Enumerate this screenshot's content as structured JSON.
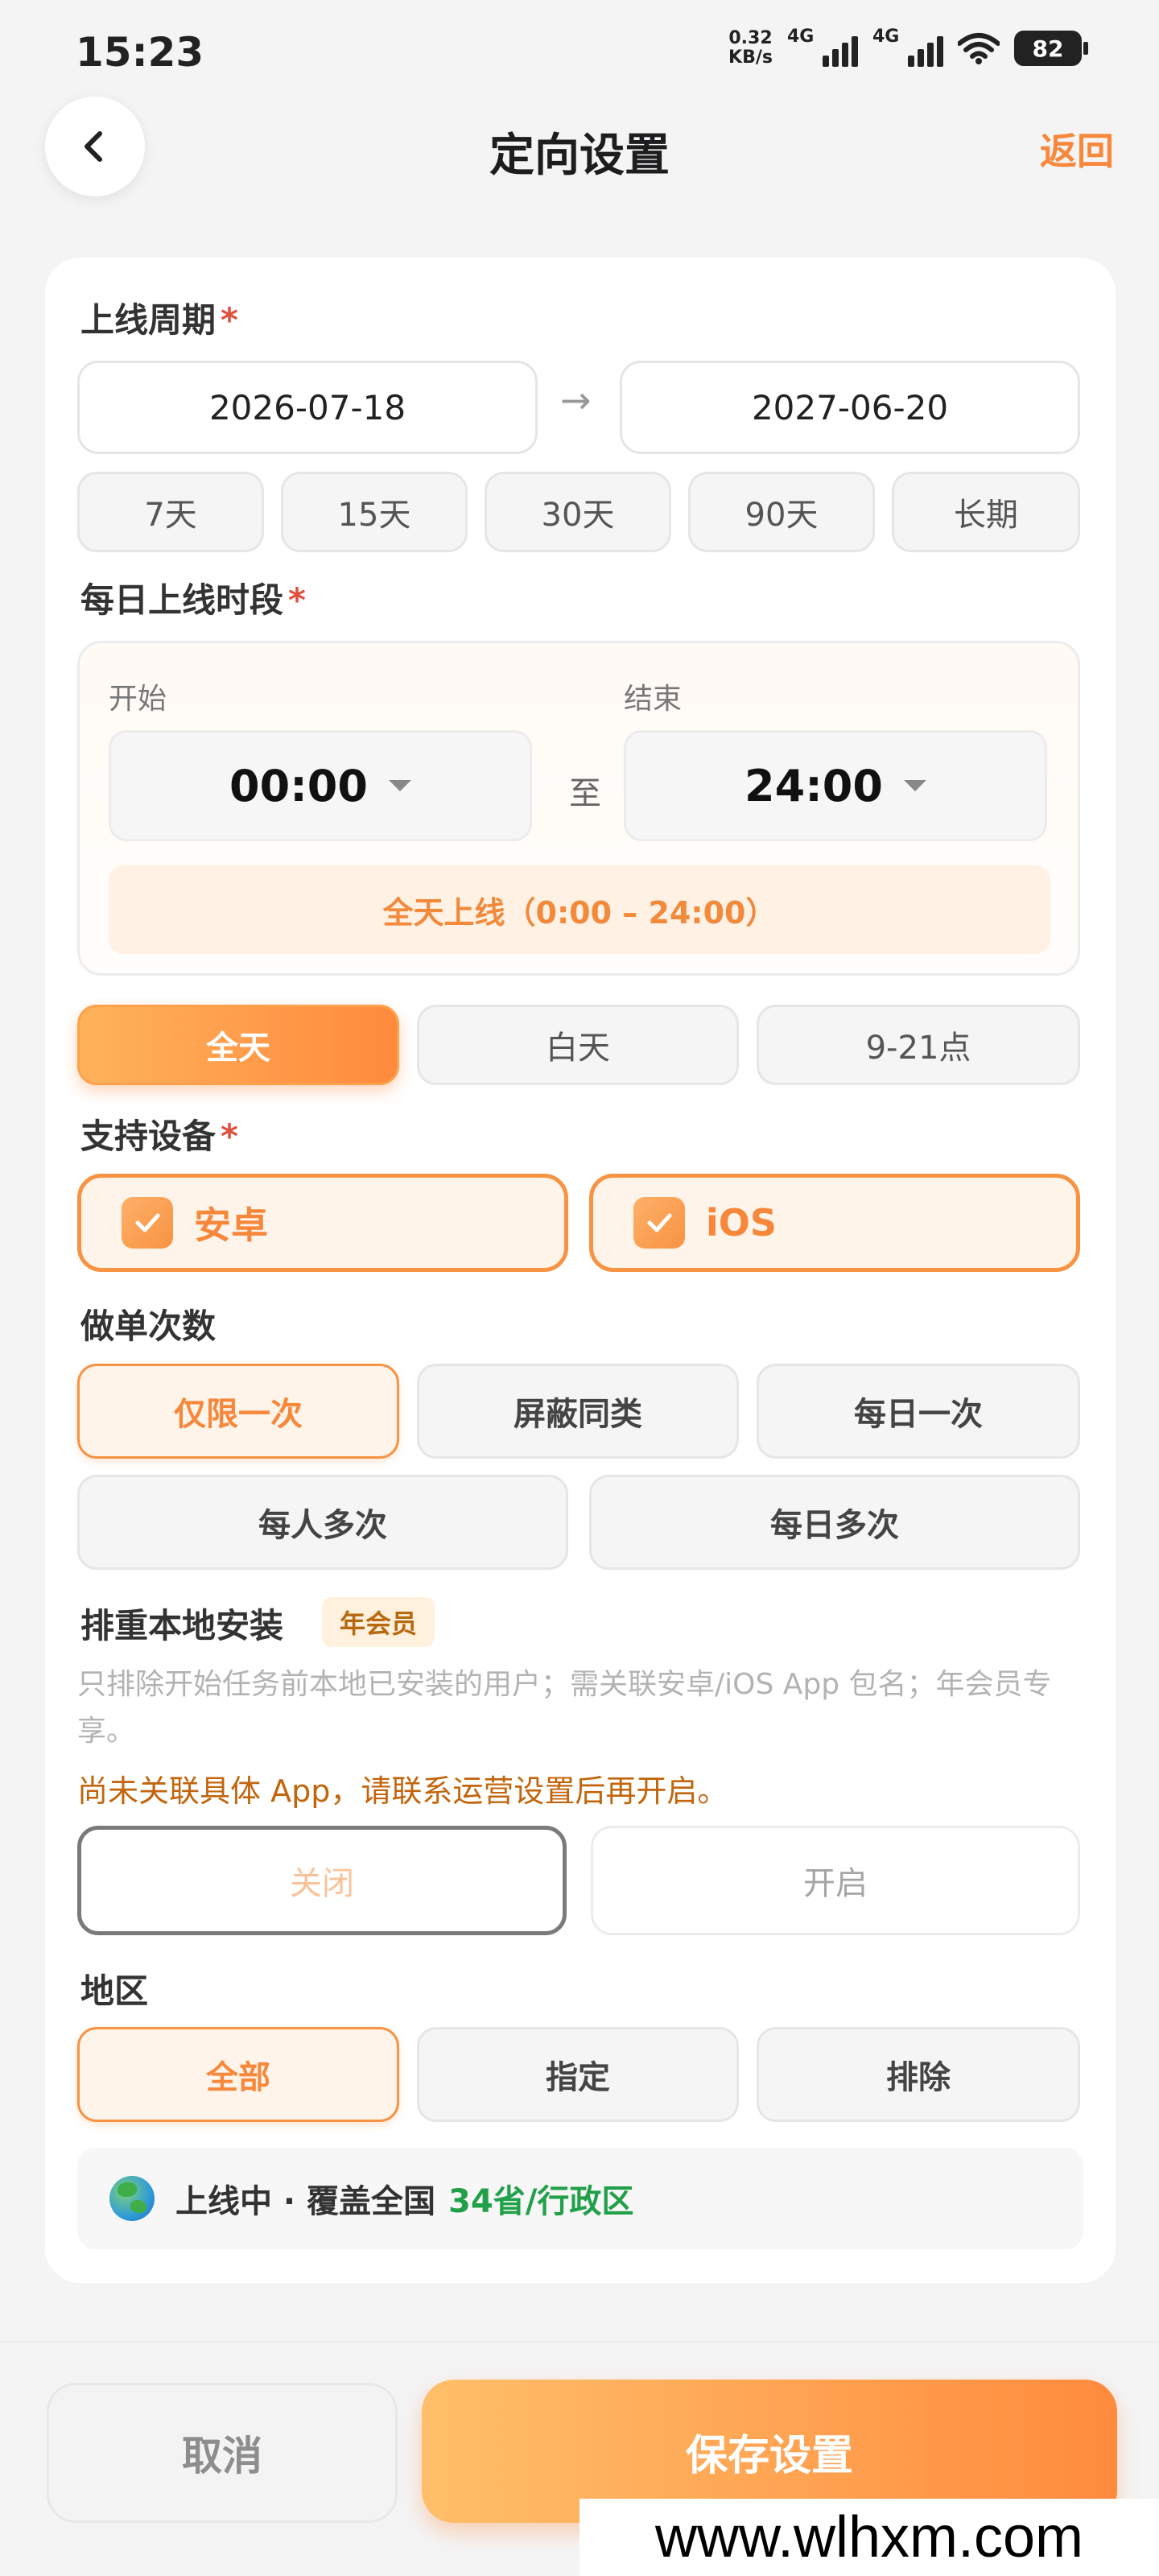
{
  "status_bar": {
    "time": "15:23",
    "net_speed_value": "0.32",
    "net_speed_unit": "KB/s",
    "signal1_gen": "4G",
    "signal2_gen": "4G",
    "battery": "82"
  },
  "nav": {
    "title": "定向设置",
    "return_label": "返回"
  },
  "online_period": {
    "title": "上线周期",
    "required_mark": "*",
    "start_date": "2026-07-18",
    "arrow": "→",
    "end_date": "2027-06-20",
    "presets": [
      "7天",
      "15天",
      "30天",
      "90天",
      "长期"
    ]
  },
  "daily_slot": {
    "title": "每日上线时段",
    "required_mark": "*",
    "start_label": "开始",
    "start_value": "00:00",
    "to_label": "至",
    "end_label": "结束",
    "end_value": "24:00",
    "summary": "全天上线（0:00 – 24:00）",
    "options": [
      "全天",
      "白天",
      "9-21点"
    ],
    "selected": "全天"
  },
  "devices": {
    "title": "支持设备",
    "required_mark": "*",
    "items": [
      {
        "label": "安卓",
        "checked": true
      },
      {
        "label": "iOS",
        "checked": true
      }
    ]
  },
  "order_count": {
    "title": "做单次数",
    "options_row1": [
      "仅限一次",
      "屏蔽同类",
      "每日一次"
    ],
    "options_row2": [
      "每人多次",
      "每日多次"
    ],
    "selected": "仅限一次"
  },
  "dedup_install": {
    "title": "排重本地安装",
    "badge": "年会员",
    "description": "只排除开始任务前本地已安装的用户；需关联安卓/iOS App 包名；年会员专享。",
    "warning": "尚未关联具体 App，请联系运营设置后再开启。",
    "off_label": "关闭",
    "on_label": "开启"
  },
  "region": {
    "title": "地区",
    "options": [
      "全部",
      "指定",
      "排除"
    ],
    "selected": "全部",
    "status_text": "上线中 · 覆盖全国",
    "coverage": "34省/行政区"
  },
  "footer": {
    "cancel_label": "取消",
    "save_label": "保存设置"
  },
  "watermark": "www.wlhxm.com",
  "colors": {
    "accent": "#f7873a",
    "required": "#e0503d",
    "coverage_green": "#22a049",
    "warning": "#c2650c"
  }
}
